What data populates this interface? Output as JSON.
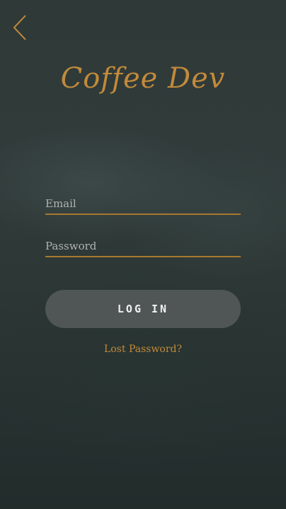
{
  "header": {
    "back_icon": "chevron-left-icon",
    "app_title": "Coffee Dev"
  },
  "form": {
    "email": {
      "value": "",
      "placeholder": "Email"
    },
    "password": {
      "value": "",
      "placeholder": "Password"
    },
    "login_label": "LOG IN",
    "lost_password_label": "Lost Password?"
  },
  "colors": {
    "accent": "#c28a3a",
    "underline": "#a9782f",
    "button_bg": "#4f5655",
    "background": "#2a3433",
    "text_light": "#f1f1f1",
    "placeholder": "#aeb3b1"
  }
}
